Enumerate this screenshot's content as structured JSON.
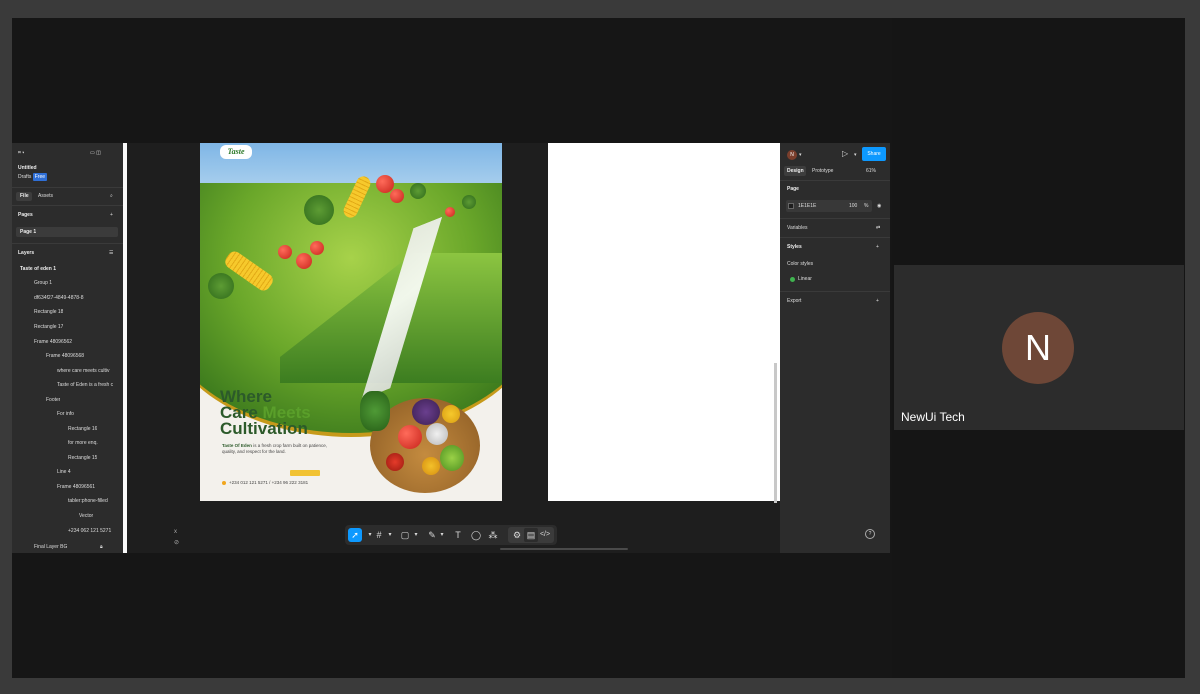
{
  "left_panel": {
    "file_name": "Untitled",
    "drafts_label": "Drafts",
    "plan_badge": "Free",
    "tabs": [
      "File",
      "Assets"
    ],
    "pages_header": "Pages",
    "page_item": "Page 1",
    "layers_header": "Layers",
    "layers": [
      "Taste of eden 1",
      "Group 1",
      "df634f27-4849-4878-8",
      "Rectangle 18",
      "Rectangle 17",
      "Frame 48096562",
      "Frame 48096568",
      "where care meets cultiv",
      "Taste of Eden is a fresh c",
      "Footer",
      "For info",
      "Rectangle 16",
      "for more enq.",
      "Rectangle 15",
      "Line 4",
      "Frame 48096561",
      "tabler:phone-filled",
      "Vector",
      "+234 062 121 5271",
      "Final Layer BG"
    ]
  },
  "poster": {
    "logo": "Taste",
    "headline_1": "Where",
    "headline_2": "Care",
    "headline_3": "Meets",
    "headline_4": "Cultivation",
    "tagline_bold": "Taste Of Eden",
    "tagline_rest": " is a fresh crop farm built on patience, quality, and respect for the land.",
    "phone": "+234 012 121 5271 / +234 96 222 3181"
  },
  "toolbar": {
    "tools": [
      "move-tool",
      "frame-tool",
      "shape-tool",
      "pen-tool",
      "text-tool",
      "comment-tool",
      "actions-tool"
    ],
    "close_mark": "x"
  },
  "right_panel": {
    "avatar_initial": "N",
    "share_label": "Share",
    "tab_design": "Design",
    "tab_prototype": "Prototype",
    "zoom": "61%",
    "page_header": "Page",
    "page_color": "1E1E1E",
    "page_opacity": "100",
    "percent_sign": "%",
    "variables_label": "Variables",
    "styles_header": "Styles",
    "color_styles_label": "Color styles",
    "linear_style": "Linear",
    "export_label": "Export",
    "help": "?"
  },
  "participant": {
    "initial": "N",
    "name": "NewUi Tech"
  },
  "colors": {
    "accent": "#0d99ff",
    "avatar_bg": "#6e4737",
    "poster_green": "#2c5a2a"
  }
}
